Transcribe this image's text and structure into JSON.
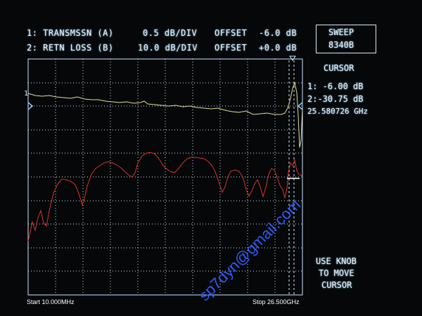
{
  "header": {
    "ch1": {
      "label": "1: TRANSMSSN (A)",
      "scale": "0.5 dB/DIV",
      "offset_label": "OFFSET",
      "offset_value": "-6.0 dB"
    },
    "ch2": {
      "label": "2: RETN LOSS (B)",
      "scale": "10.0 dB/DIV",
      "offset_label": "OFFSET",
      "offset_value": "+0.0 dB"
    }
  },
  "sweep": {
    "line1": "SWEEP",
    "line2": "8340B"
  },
  "cursor": {
    "title": "CURSOR",
    "ch1_value": "1: -6.00 dB",
    "ch2_value": "2:-30.75 dB",
    "frequency": "25.580726 GHz"
  },
  "knob_hint": {
    "line1": "USE KNOB",
    "line2": "TO MOVE",
    "line3": "CURSOR"
  },
  "footer": {
    "start": "Start 10.000MHz",
    "stop": "Stop 26.500GHz"
  },
  "watermark": "sp7dyn@gmail.com",
  "trace_marker": "1",
  "colors": {
    "grid": "#cfe6ff",
    "trace1": "#e6dca0",
    "trace2": "#d8342a",
    "text": "#e6f4ff",
    "watermark": "#2b5cff"
  }
}
